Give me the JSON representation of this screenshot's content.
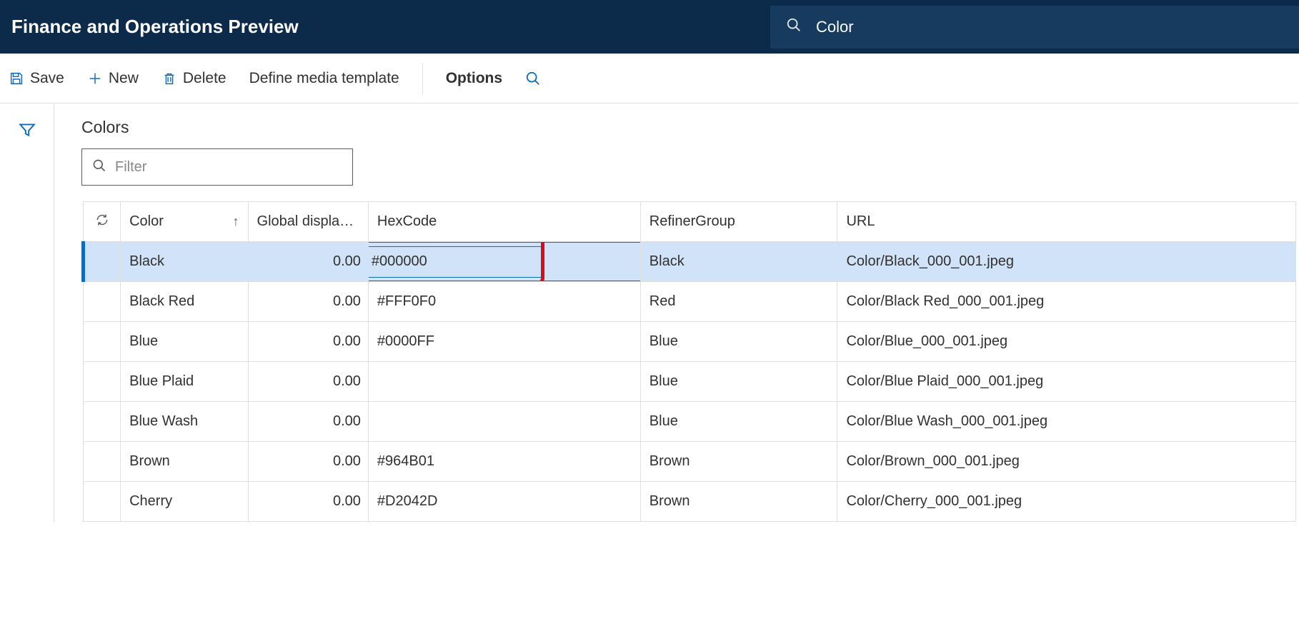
{
  "topbar": {
    "title": "Finance and Operations Preview",
    "search_value": "Color"
  },
  "commands": {
    "save": "Save",
    "new": "New",
    "delete": "Delete",
    "define_media": "Define media template",
    "options": "Options"
  },
  "content": {
    "heading": "Colors",
    "filter_placeholder": "Filter"
  },
  "columns": {
    "color": "Color",
    "gdo": "Global display ...",
    "hex": "HexCode",
    "refiner": "RefinerGroup",
    "url": "URL"
  },
  "rows": [
    {
      "color": "Black",
      "gdo": "0.00",
      "hex": "#000000",
      "refiner": "Black",
      "url": "Color/Black_000_001.jpeg",
      "selected": true,
      "editing": true
    },
    {
      "color": "Black Red",
      "gdo": "0.00",
      "hex": "#FFF0F0",
      "refiner": "Red",
      "url": "Color/Black Red_000_001.jpeg",
      "selected": false
    },
    {
      "color": "Blue",
      "gdo": "0.00",
      "hex": "#0000FF",
      "refiner": "Blue",
      "url": "Color/Blue_000_001.jpeg",
      "selected": false
    },
    {
      "color": "Blue Plaid",
      "gdo": "0.00",
      "hex": "",
      "refiner": "Blue",
      "url": "Color/Blue Plaid_000_001.jpeg",
      "selected": false
    },
    {
      "color": "Blue Wash",
      "gdo": "0.00",
      "hex": "",
      "refiner": "Blue",
      "url": "Color/Blue Wash_000_001.jpeg",
      "selected": false
    },
    {
      "color": "Brown",
      "gdo": "0.00",
      "hex": "#964B01",
      "refiner": "Brown",
      "url": "Color/Brown_000_001.jpeg",
      "selected": false
    },
    {
      "color": "Cherry",
      "gdo": "0.00",
      "hex": "#D2042D",
      "refiner": "Brown",
      "url": "Color/Cherry_000_001.jpeg",
      "selected": false
    }
  ]
}
